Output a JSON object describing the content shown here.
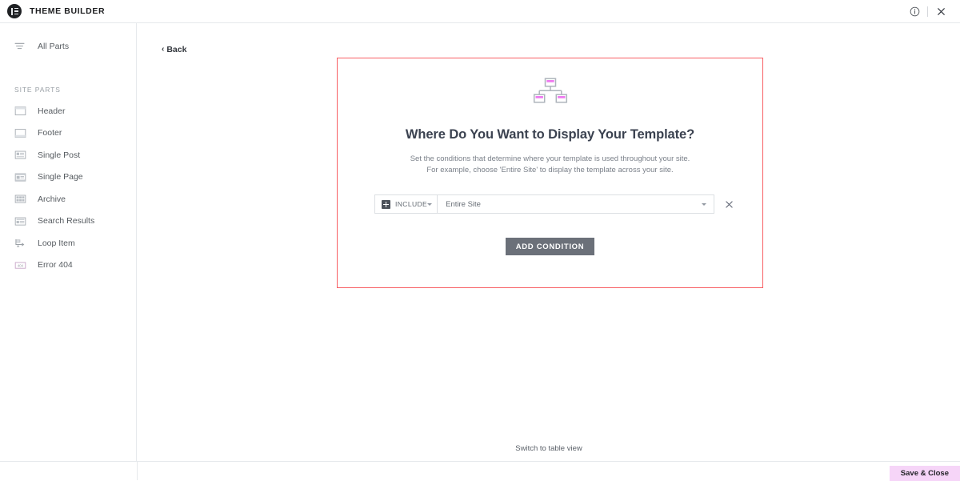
{
  "topbar": {
    "brand_title": "THEME BUILDER",
    "logo_icon": "elementor-logo-icon",
    "info_icon": "info-circle-icon",
    "close_icon": "close-icon"
  },
  "sidebar": {
    "all_parts": {
      "label": "All Parts",
      "icon": "filter-lines-icon"
    },
    "section_header": "SITE PARTS",
    "items": [
      {
        "label": "Header",
        "icon": "header-layout-icon"
      },
      {
        "label": "Footer",
        "icon": "footer-layout-icon"
      },
      {
        "label": "Single Post",
        "icon": "single-post-icon"
      },
      {
        "label": "Single Page",
        "icon": "single-page-icon"
      },
      {
        "label": "Archive",
        "icon": "archive-grid-icon"
      },
      {
        "label": "Search Results",
        "icon": "search-results-icon"
      },
      {
        "label": "Loop Item",
        "icon": "loop-item-icon"
      },
      {
        "label": "Error 404",
        "icon": "error-404-icon"
      }
    ]
  },
  "main": {
    "back_label": "Back",
    "back_icon": "chevron-left-icon",
    "switch_view_label": "Switch to table view"
  },
  "dialog": {
    "icon": "sitemap-icon",
    "title": "Where Do You Want to Display Your Template?",
    "subtitle_line1": "Set the conditions that determine where your template is used throughout your site.",
    "subtitle_line2": "For example, choose 'Entire Site' to display the template across your site.",
    "condition": {
      "include_label": "INCLUDE",
      "include_icon": "plus-square-icon",
      "include_caret_icon": "chevron-down-icon",
      "select_value": "Entire Site",
      "select_caret_icon": "chevron-down-icon",
      "remove_icon": "close-icon"
    },
    "add_condition_label": "ADD CONDITION",
    "border_color": "#f85f63"
  },
  "footer": {
    "save_close_label": "Save & Close",
    "save_close_bg": "#f6d5f8"
  },
  "colors": {
    "accent_pink": "#ee6ee8",
    "icon_gray": "#9aa0a6",
    "text_gray": "#565b60",
    "button_gray": "#6b7079"
  }
}
